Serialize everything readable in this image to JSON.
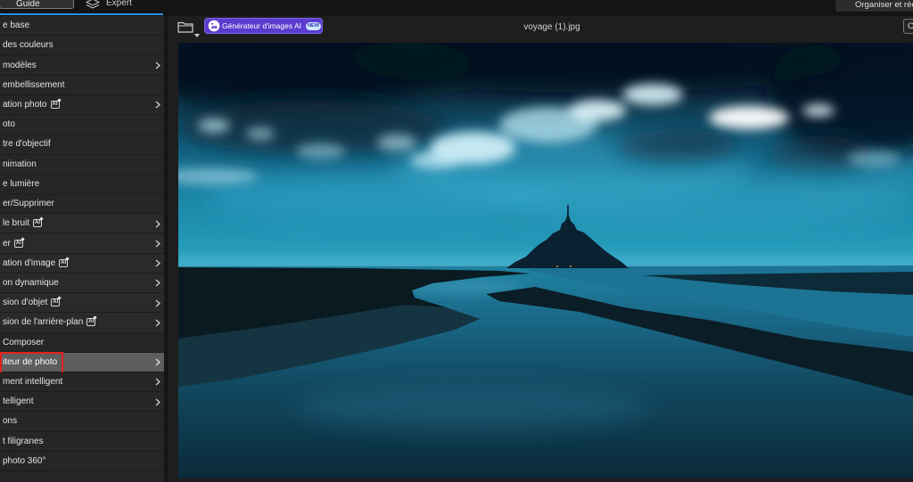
{
  "top_bar": {
    "mode_tabs": [
      {
        "label": "Guide",
        "selected": true
      },
      {
        "label": "Expert",
        "selected": false
      }
    ],
    "organize_button": "Organiser et réc"
  },
  "sidebar": {
    "ai_icon_text": "AI",
    "items": [
      {
        "label": "e base",
        "ai": false,
        "submenu": false,
        "selected": false
      },
      {
        "label": "des couleurs",
        "ai": false,
        "submenu": false,
        "selected": false
      },
      {
        "label": "modèles",
        "ai": false,
        "submenu": true,
        "selected": false
      },
      {
        "label": "embellissement",
        "ai": false,
        "submenu": false,
        "selected": false
      },
      {
        "label": "ation photo",
        "ai": true,
        "submenu": true,
        "selected": false
      },
      {
        "label": "oto",
        "ai": false,
        "submenu": false,
        "selected": false
      },
      {
        "label": "tre d'objectif",
        "ai": false,
        "submenu": false,
        "selected": false
      },
      {
        "label": "nimation",
        "ai": false,
        "submenu": false,
        "selected": false
      },
      {
        "label": "e lumière",
        "ai": false,
        "submenu": false,
        "selected": false
      },
      {
        "label": "er/Supprimer",
        "ai": false,
        "submenu": false,
        "selected": false
      },
      {
        "label": "le bruit",
        "ai": true,
        "submenu": true,
        "selected": false
      },
      {
        "label": "er",
        "ai": true,
        "submenu": true,
        "selected": false
      },
      {
        "label": "ation d'image",
        "ai": true,
        "submenu": true,
        "selected": false
      },
      {
        "label": "on dynamique",
        "ai": false,
        "submenu": true,
        "selected": false
      },
      {
        "label": "sion d'objet",
        "ai": true,
        "submenu": true,
        "selected": false
      },
      {
        "label": "sion de l'arrière-plan",
        "ai": true,
        "submenu": true,
        "selected": false
      },
      {
        "label": "Composer",
        "ai": false,
        "submenu": false,
        "selected": false
      },
      {
        "label": "iteur de photo",
        "ai": false,
        "submenu": true,
        "selected": true
      },
      {
        "label": "ment intelligent",
        "ai": false,
        "submenu": true,
        "selected": false
      },
      {
        "label": "telligent",
        "ai": false,
        "submenu": true,
        "selected": false
      },
      {
        "label": "ons",
        "ai": false,
        "submenu": false,
        "selected": false
      },
      {
        "label": "t filigranes",
        "ai": false,
        "submenu": false,
        "selected": false
      },
      {
        "label": "photo 360°",
        "ai": false,
        "submenu": false,
        "selected": false
      }
    ]
  },
  "toolbar": {
    "ai_generator": {
      "label": "Générateur d'images AI",
      "badge": "NEW"
    },
    "file_name": "voyage (1).jpg",
    "right_button": "C"
  },
  "colors": {
    "accent_blue": "#2f8de4",
    "ai_button": "#5b3ccf",
    "ai_badge": "#cfe9ff",
    "panel_bg": "#262626",
    "selected_row": "#5e5e5e",
    "highlight_outline": "#e3211b",
    "app_bg": "#1e1e1e"
  },
  "icons": [
    "layers-icon",
    "folder-icon",
    "chevron-down-icon",
    "ai-image-icon",
    "ai-icon",
    "chevron-right-icon"
  ]
}
